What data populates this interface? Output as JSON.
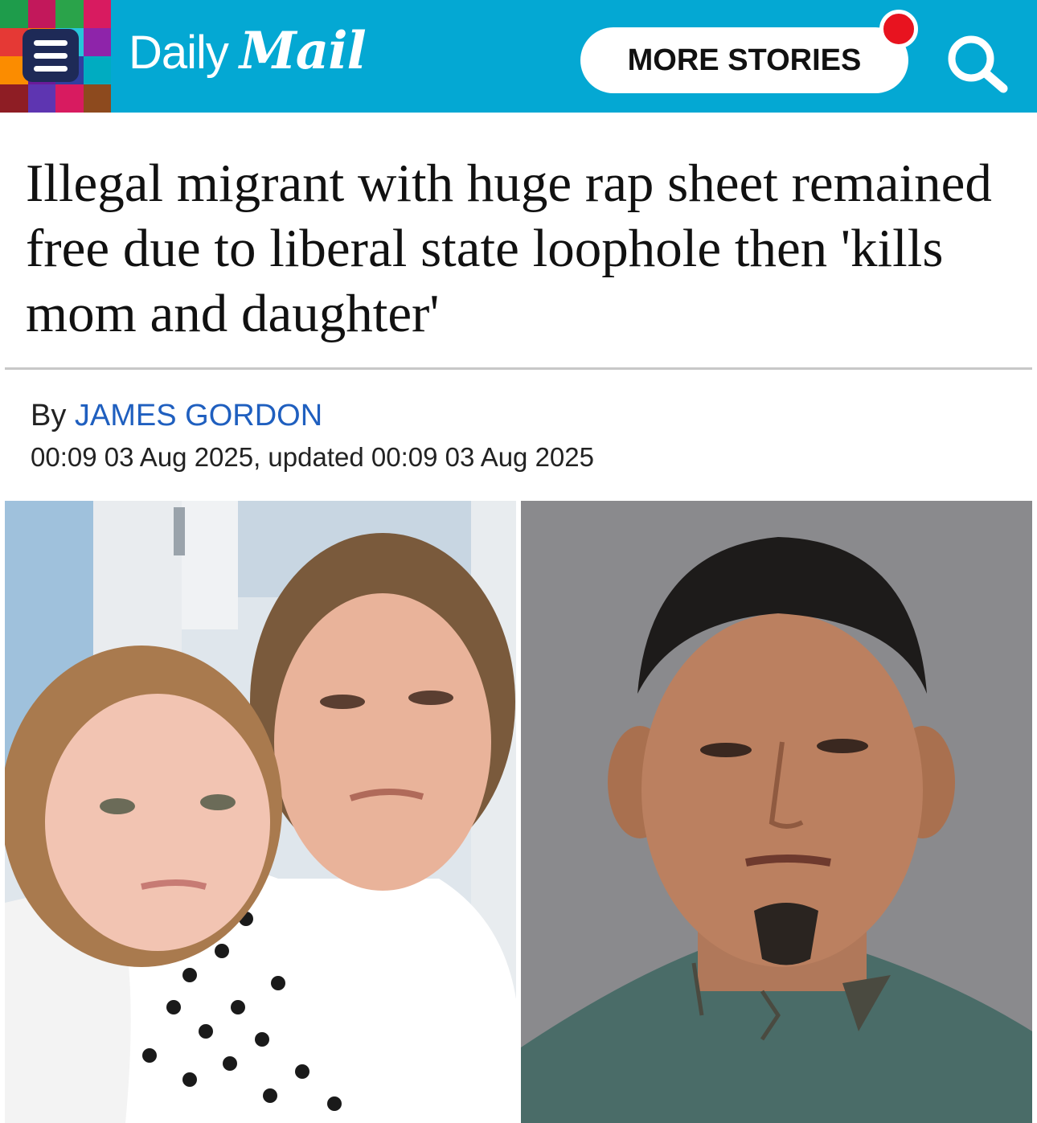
{
  "header": {
    "brand_word_1": "Daily",
    "brand_word_2": "Mail",
    "more_stories_label": "MORE STORIES",
    "brand_color": "#04a8d3",
    "notification_color": "#e8131f",
    "menu_icon": "hamburger-icon",
    "search_icon": "search-icon"
  },
  "article": {
    "headline": "Illegal migrant with huge rap sheet remained free due to liberal state loophole then 'kills mom and daughter'",
    "byline_prefix": "By",
    "author": "JAMES GORDON",
    "timestamp": "00:09 03 Aug 2025, updated 00:09 03 Aug 2025",
    "link_color": "#1f5fbf"
  }
}
